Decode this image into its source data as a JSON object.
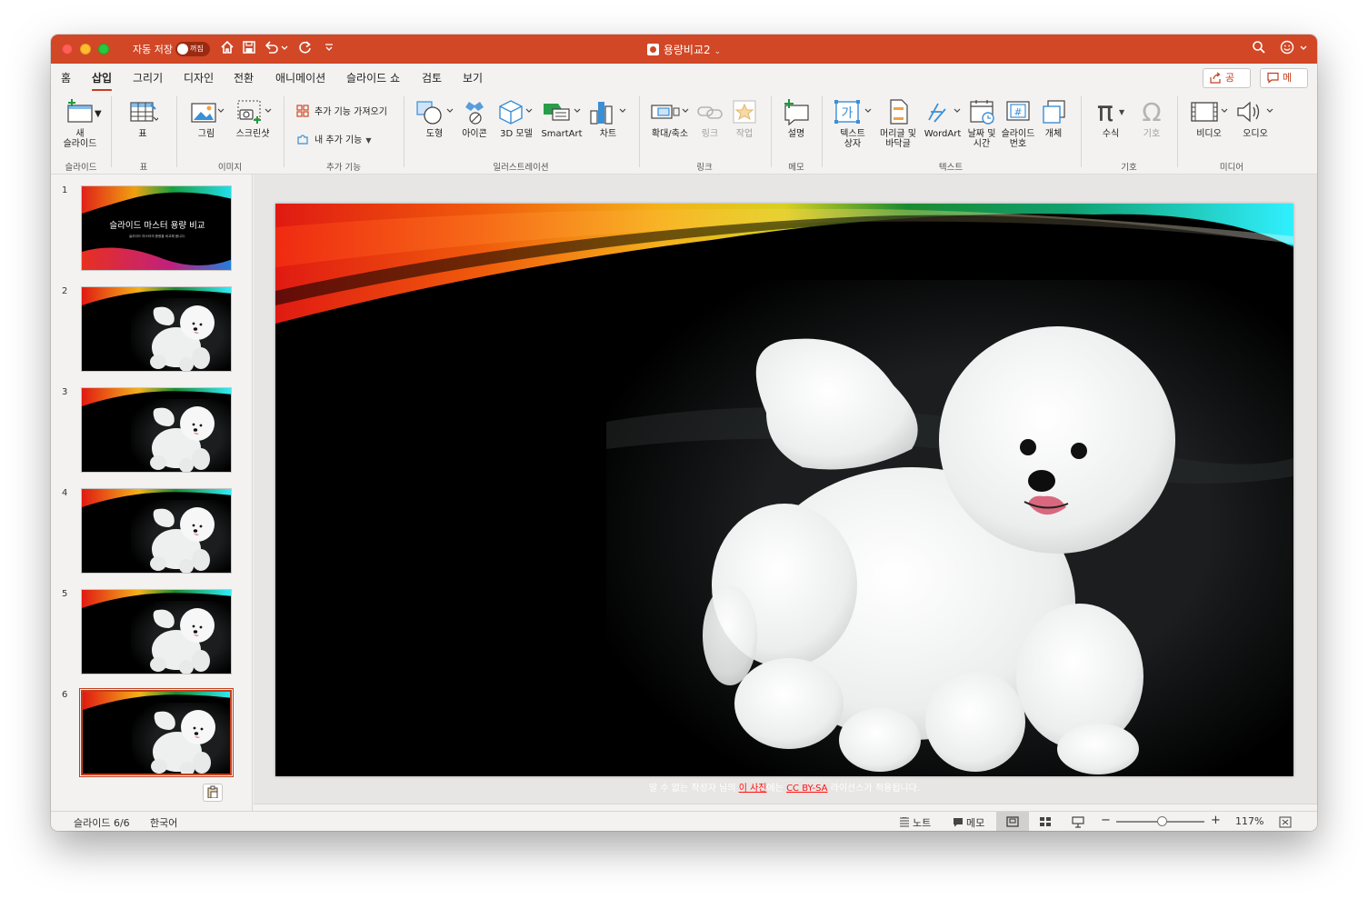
{
  "titlebar": {
    "autosave_label": "자동 저장",
    "autosave_state": "꺼짐",
    "doc_title": "용량비교2",
    "accent": "#d24726"
  },
  "tabs": [
    {
      "label": "홈"
    },
    {
      "label": "삽입",
      "active": true
    },
    {
      "label": "그리기"
    },
    {
      "label": "디자인"
    },
    {
      "label": "전환"
    },
    {
      "label": "애니메이션"
    },
    {
      "label": "슬라이드 쇼"
    },
    {
      "label": "검토"
    },
    {
      "label": "보기"
    }
  ],
  "share_label": "공유",
  "memo_label": "메모",
  "ribbon": {
    "new_slide_1": "새",
    "new_slide_2": "슬라이드",
    "table": "표",
    "picture": "그림",
    "screenshot": "스크린샷",
    "get_addins": "추가 기능 가져오기",
    "my_addins": "내 추가 기능",
    "shapes": "도형",
    "icons": "아이콘",
    "model3d": "3D 모델",
    "smartart": "SmartArt",
    "chart": "차트",
    "zoom": "확대/축소",
    "link": "링크",
    "action": "작업",
    "comment": "설명",
    "textbox_1": "텍스트",
    "textbox_2": "상자",
    "header_1": "머리글 및",
    "header_2": "바닥글",
    "wordart": "WordArt",
    "datetime_1": "날짜 및",
    "datetime_2": "시간",
    "slidenum_1": "슬라이드",
    "slidenum_2": "번호",
    "object": "개체",
    "equation": "수식",
    "symbol": "기호",
    "video": "비디오",
    "audio": "오디오",
    "textbox_glyph": "가",
    "slidenum_glyph": "#",
    "equation_glyph": "π",
    "symbol_glyph": "Ω",
    "groups": {
      "slides": "슬라이드",
      "table": "표",
      "images": "이미지",
      "addins": "추가 기능",
      "illustrations": "일러스트레이션",
      "links": "링크",
      "comments": "메모",
      "text": "텍스트",
      "symbols": "기호",
      "media": "미디어"
    }
  },
  "slides": {
    "numbers": [
      "1",
      "2",
      "3",
      "4",
      "5",
      "6"
    ],
    "slide1_title": "슬라이드 마스터 용량 비교",
    "slide1_subtitle": "슬라이드 마스터의 용량을 비교해 봅니다.",
    "selected_index": 6
  },
  "caption": {
    "prefix": "알 수 없는 작성자 님의",
    "link1": "이 사진",
    "middle": "에는",
    "link2": "CC BY-SA",
    "suffix": "라이선스가 적용됩니다."
  },
  "statusbar": {
    "slide_pos": "슬라이드 6/6",
    "language": "한국어",
    "notes": "노트",
    "comments": "메모",
    "zoom": "117%",
    "zoom_minus": "−",
    "zoom_plus": "+"
  },
  "icons": [
    "search-icon",
    "smiley-icon",
    "home-icon",
    "save-icon",
    "undo-icon",
    "redo-icon",
    "customize-icon",
    "share-icon",
    "comment-icon"
  ]
}
